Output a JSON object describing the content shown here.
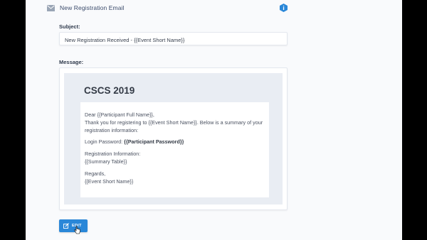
{
  "header": {
    "title": "New Registration Email",
    "mail_icon": "envelope-icon",
    "info_icon": "info-hexagon-icon",
    "accent": "#2a87d8"
  },
  "subject": {
    "label": "Subject:",
    "value": "New Registration Received - {{Event Short Name}}"
  },
  "message": {
    "label": "Message:",
    "heading": "CSCS 2019",
    "lines": {
      "greeting": "Dear {{Participant Full Name}},",
      "thanks1": "Thank you for registering to {{Event Short Name}}. Below is a summary of your",
      "thanks2": "registration information:",
      "password_label": "Login Password: ",
      "password_value": "{{Participant Password}}",
      "reg_info": "Registration Information:",
      "summary": "{{Summary Table}}",
      "regards": "Regards,",
      "signature": "{{Event Short Name}}"
    }
  },
  "actions": {
    "edit_label": "EDIT",
    "edit_icon": "edit-icon"
  }
}
